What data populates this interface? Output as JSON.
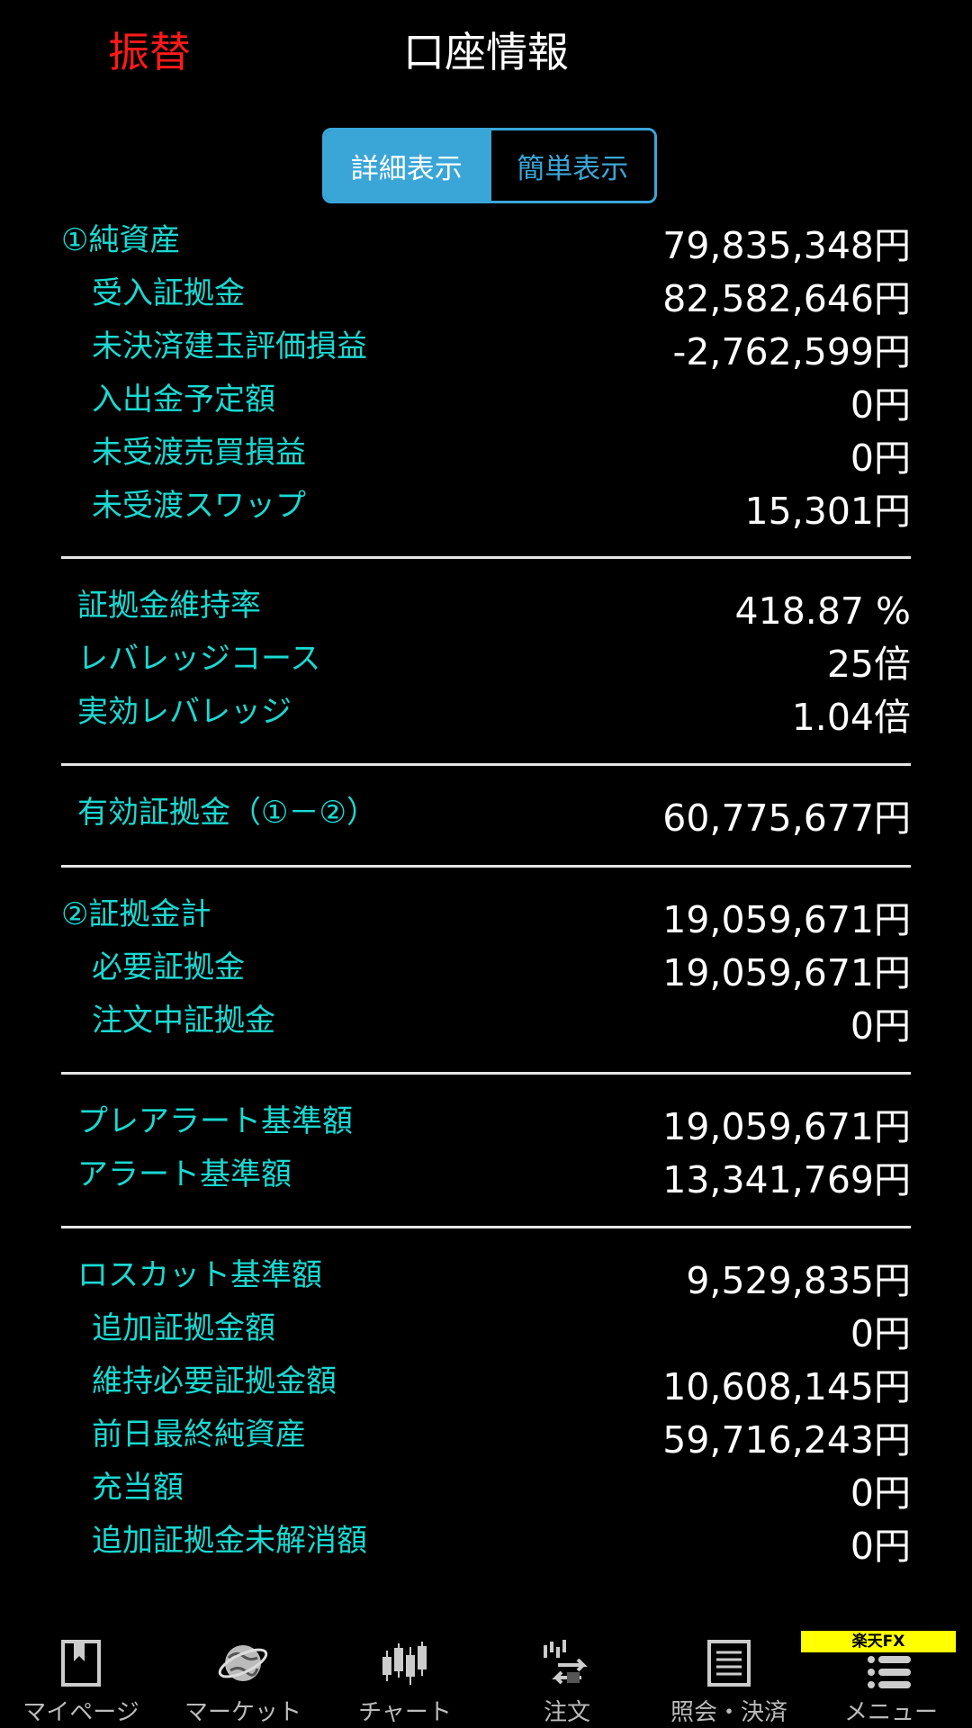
{
  "header": {
    "transfer_label": "振替",
    "title": "口座情報"
  },
  "toggle": {
    "detail_label": "詳細表示",
    "simple_label": "簡単表示",
    "selected": "詳細表示"
  },
  "rows": [
    {
      "label": "①純資産",
      "value": "79,835,348円"
    },
    {
      "label": "受入証拠金",
      "value": "82,582,646円"
    },
    {
      "label": "未決済建玉評価損益",
      "value": "-2,762,599円"
    },
    {
      "label": "入出金予定額",
      "value": "0円"
    },
    {
      "label": "未受渡売買損益",
      "value": "0円"
    },
    {
      "label": "未受渡スワップ",
      "value": "15,301円"
    },
    {
      "label": "証拠金維持率",
      "value": "418.87 %"
    },
    {
      "label": "レバレッジコース",
      "value": "25倍"
    },
    {
      "label": "実効レバレッジ",
      "value": "1.04倍"
    },
    {
      "label": "有効証拠金（①－②）",
      "value": "60,775,677円"
    },
    {
      "label": "②証拠金計",
      "value": "19,059,671円"
    },
    {
      "label": "必要証拠金",
      "value": "19,059,671円"
    },
    {
      "label": "注文中証拠金",
      "value": "0円"
    },
    {
      "label": "プレアラート基準額",
      "value": "19,059,671円"
    },
    {
      "label": "アラート基準額",
      "value": "13,341,769円"
    },
    {
      "label": "ロスカット基準額",
      "value": "9,529,835円"
    },
    {
      "label": "追加証拠金額",
      "value": "0円"
    },
    {
      "label": "維持必要証拠金額",
      "value": "10,608,145円"
    },
    {
      "label": "前日最終純資産",
      "value": "59,716,243円"
    },
    {
      "label": "充当額",
      "value": "0円"
    },
    {
      "label": "追加証拠金未解消額",
      "value": "0円"
    }
  ],
  "nav": {
    "items": [
      {
        "label": "マイページ",
        "icon": "bookmark-page-icon"
      },
      {
        "label": "マーケット",
        "icon": "globe-icon"
      },
      {
        "label": "チャート",
        "icon": "candlestick-icon"
      },
      {
        "label": "注文",
        "icon": "order-icon"
      },
      {
        "label": "照会・決済",
        "icon": "list-document-icon"
      },
      {
        "label": "メニュー",
        "icon": "menu-icon"
      }
    ],
    "brand_badge": "楽天FX"
  },
  "colors": {
    "background": "#000000",
    "label": "#1ad9d1",
    "value": "#ffffff",
    "accent": "#3aa6d8",
    "transfer": "#ff1a1a",
    "badge": "#ffff00"
  }
}
